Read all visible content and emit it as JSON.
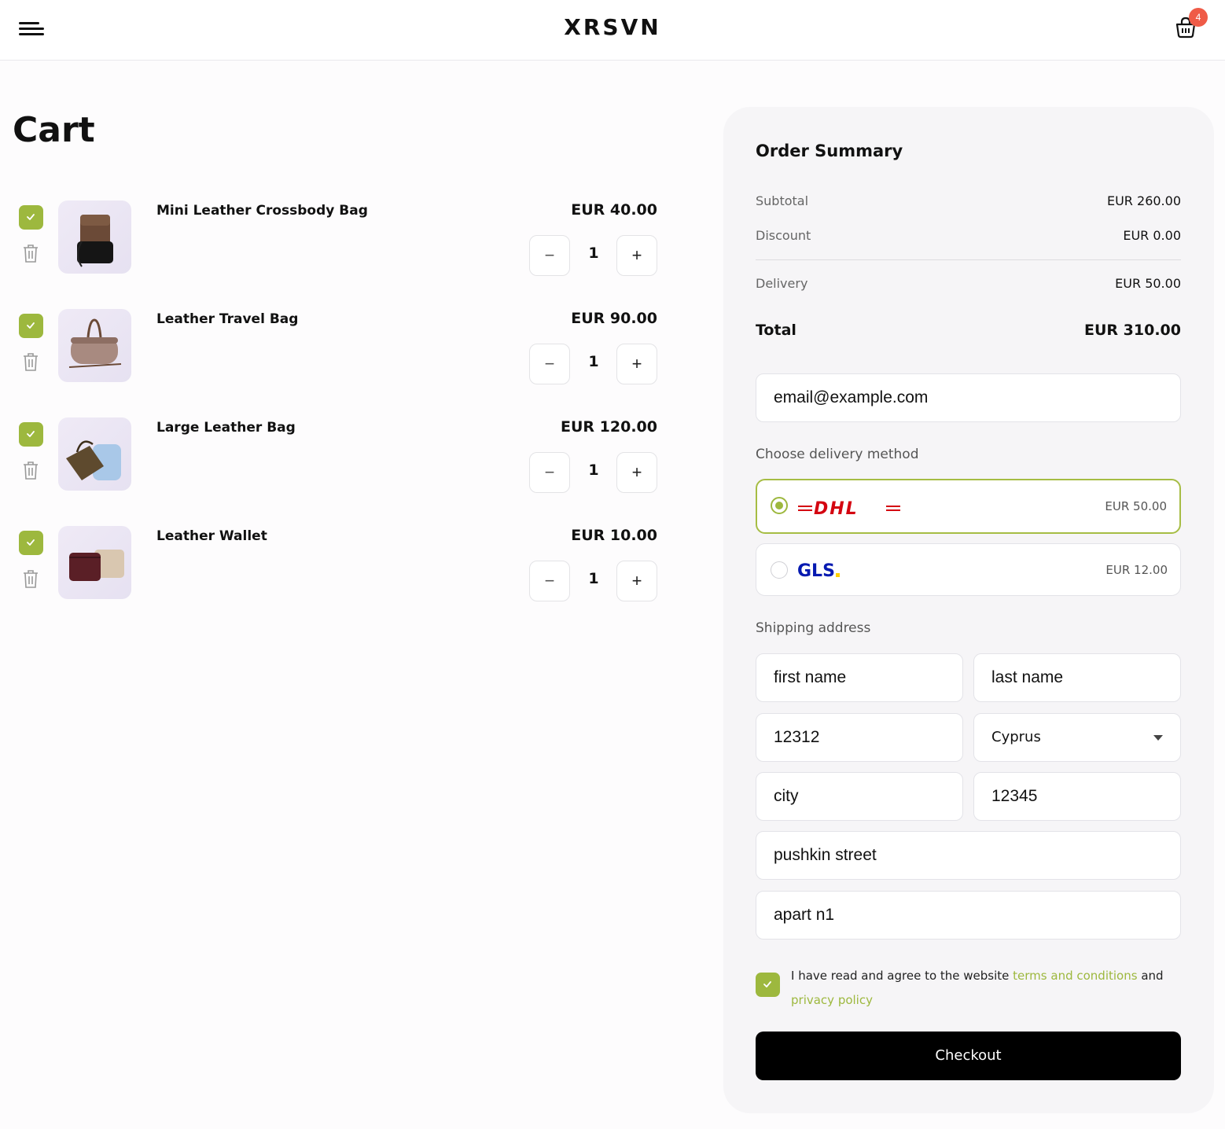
{
  "header": {
    "logo": "XRSVN",
    "cart_count": "4",
    "menu_icon": "hamburger-menu-icon",
    "cart_icon": "shopping-basket-icon"
  },
  "cart": {
    "title": "Cart",
    "items": [
      {
        "name": "Mini Leather Crossbody Bag",
        "price": "EUR 40.00",
        "qty": "1",
        "minus": "−",
        "plus": "+"
      },
      {
        "name": "Leather Travel Bag",
        "price": "EUR 90.00",
        "qty": "1",
        "minus": "−",
        "plus": "+"
      },
      {
        "name": "Large Leather Bag",
        "price": "EUR 120.00",
        "qty": "1",
        "minus": "−",
        "plus": "+"
      },
      {
        "name": "Leather Wallet",
        "price": "EUR 10.00",
        "qty": "1",
        "minus": "−",
        "plus": "+"
      }
    ]
  },
  "summary": {
    "title": "Order Summary",
    "subtotal_label": "Subtotal",
    "subtotal_value": "EUR 260.00",
    "discount_label": "Discount",
    "discount_value": "EUR 0.00",
    "delivery_label": "Delivery",
    "delivery_value": "EUR 50.00",
    "total_label": "Total",
    "total_value": "EUR 310.00",
    "email": "email@example.com",
    "delivery_method_label": "Choose delivery method",
    "delivery_options": [
      {
        "carrier": "DHL",
        "price": "EUR 50.00",
        "selected": true
      },
      {
        "carrier": "GLS",
        "price": "EUR 12.00",
        "selected": false
      }
    ],
    "shipping_label": "Shipping address",
    "address": {
      "first_name": "first name",
      "last_name": "last name",
      "phone": "12312",
      "country": "Cyprus",
      "city": "city",
      "postal_code": "12345",
      "street": "pushkin street",
      "apartment": "apart n1"
    },
    "agree_prefix": "I have read and agree to the website ",
    "terms_link": "terms and conditions",
    "agree_mid": " and",
    "privacy_link": "privacy policy",
    "checkout_label": "Checkout"
  },
  "colors": {
    "accent": "#9db83e",
    "badge": "#ef5b47",
    "dhl_red": "#d40511",
    "gls_blue": "#061ab1",
    "gls_yellow": "#ffd100"
  }
}
